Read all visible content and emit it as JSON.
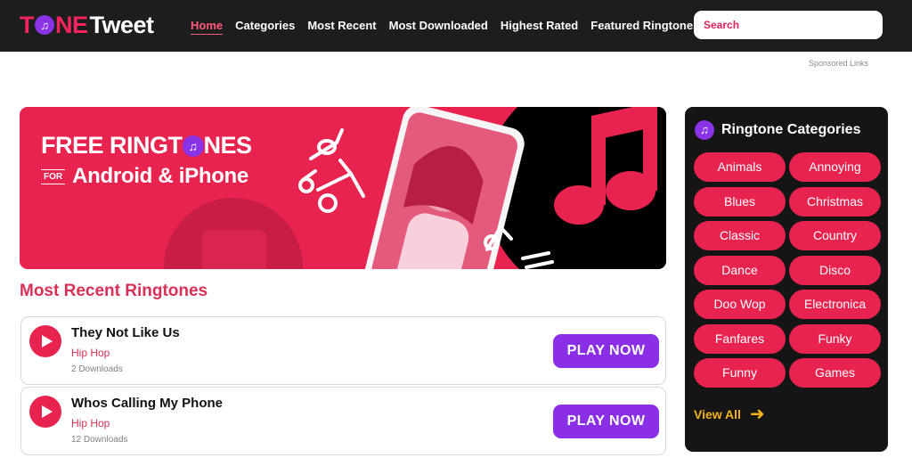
{
  "header": {
    "logo": {
      "part1": "T",
      "part2": "NE",
      "part3": "Tweet"
    },
    "nav": [
      "Home",
      "Categories",
      "Most Recent",
      "Most Downloaded",
      "Highest Rated",
      "Featured Ringtones"
    ],
    "active_nav": "Home",
    "search_placeholder": "Search"
  },
  "sponsored": "Sponsored Links",
  "banner": {
    "title_part1": "FREE RINGT",
    "title_part2": "NES",
    "for_label": "FOR",
    "subtitle": "Android & iPhone"
  },
  "section_title": "Most Recent Ringtones",
  "ringtones": [
    {
      "title": "They Not Like Us",
      "genre": "Hip Hop",
      "downloads": "2 Downloads",
      "button": "PLAY NOW"
    },
    {
      "title": "Whos Calling My Phone",
      "genre": "Hip Hop",
      "downloads": "12 Downloads",
      "button": "PLAY NOW"
    }
  ],
  "sidebar": {
    "title": "Ringtone Categories",
    "categories": [
      "Animals",
      "Annoying",
      "Blues",
      "Christmas",
      "Classic",
      "Country",
      "Dance",
      "Disco",
      "Doo Wop",
      "Electronica",
      "Fanfares",
      "Funky",
      "Funny",
      "Games"
    ],
    "view_all": "View All"
  },
  "colors": {
    "accent": "#e8234f",
    "purple": "#8a2ee8",
    "header_bg": "#1d1d1d",
    "sidebar_bg": "#151515",
    "link_yellow": "#f4b41a"
  },
  "icons": {
    "logo_note": "music-note-icon",
    "play": "play-icon",
    "arrow": "arrow-right-icon"
  }
}
